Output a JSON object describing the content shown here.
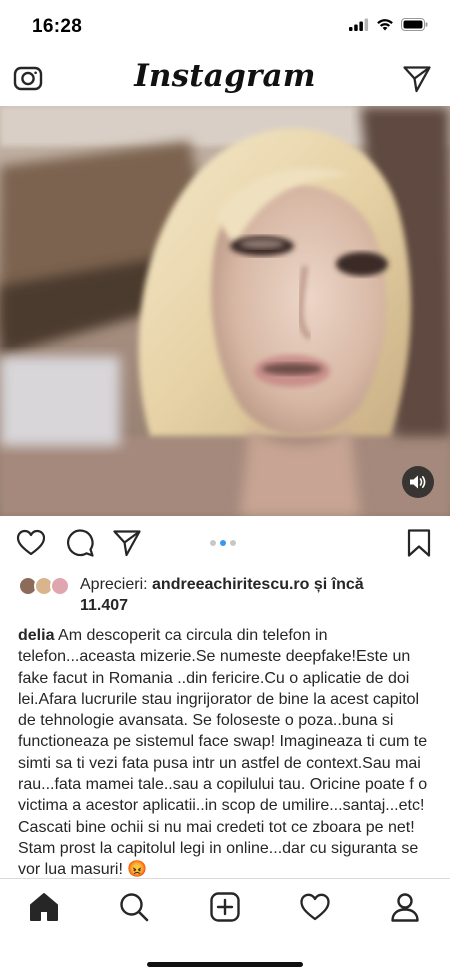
{
  "status_bar": {
    "time": "16:28"
  },
  "header": {
    "logo_text": "Instagram",
    "camera_icon": "camera-icon",
    "direct_icon": "direct-message-icon"
  },
  "media": {
    "sound_icon": "speaker-icon",
    "carousel": {
      "count": 3,
      "active_index": 1
    }
  },
  "actions": {
    "like_icon": "heart-icon",
    "comment_icon": "comment-icon",
    "share_icon": "paper-plane-icon",
    "save_icon": "bookmark-icon"
  },
  "likes": {
    "prefix": "Aprecieri: ",
    "user": "andreeachiritescu.ro",
    "suffix": " și încă",
    "count": "11.407"
  },
  "post": {
    "username": "delia",
    "caption": "Am descoperit ca circula din telefon in telefon...aceasta mizerie.Se numeste deepfake!Este un fake facut in Romania ..din fericire.Cu o aplicatie de doi lei.Afara lucrurile stau ingrijorator de bine la acest capitol de tehnologie avansata. Se foloseste o poza..buna si  functioneaza pe sistemul face swap! Imagineaza ti cum te simti sa ti vezi fata pusa intr un astfel de context.Sau mai rau...fata mamei tale..sau a copilului tau. Oricine poate f o victima a acestor aplicatii..in scop de umilire...santaj...etc! Cascati bine ochii si nu mai credeti tot ce zboara pe net! Stam prost la capitolul legi in online...dar cu siguranta se vor lua masuri!",
    "emoji": "😡"
  },
  "tab_bar": {
    "items": [
      "home-icon",
      "search-icon",
      "new-post-icon",
      "activity-icon",
      "profile-icon"
    ]
  },
  "colors": {
    "accent": "#3897f0",
    "text": "#262626",
    "divider": "#dbdbdb"
  }
}
